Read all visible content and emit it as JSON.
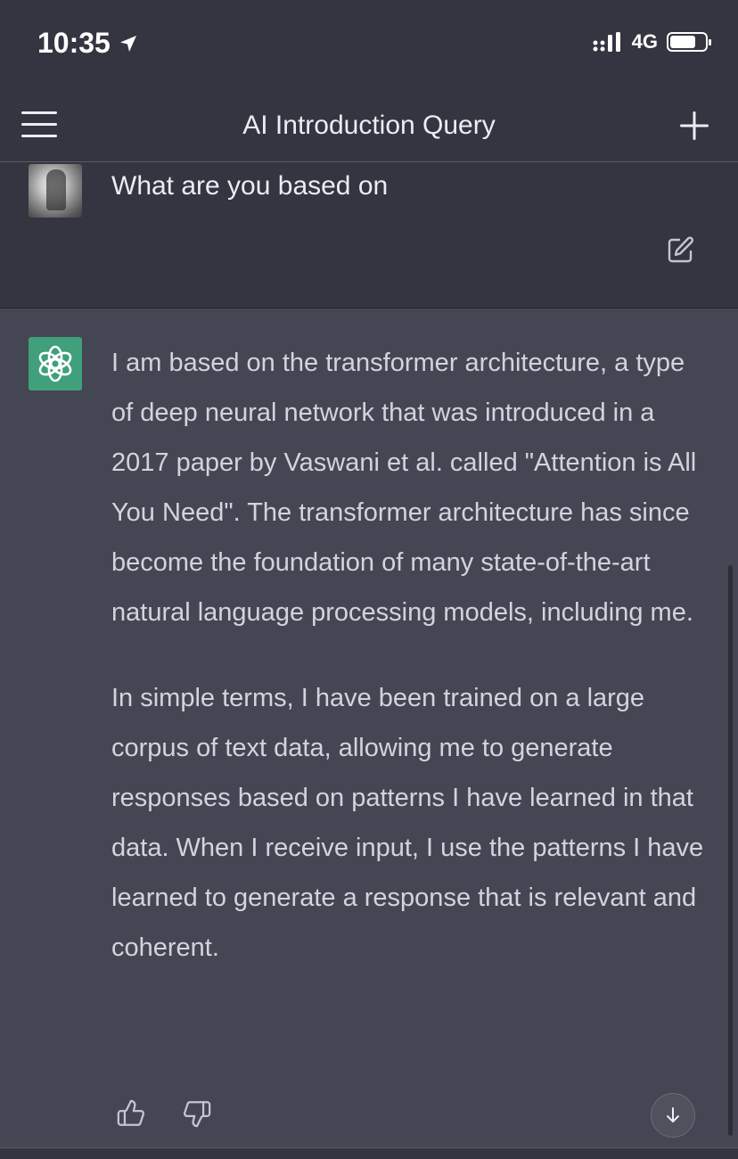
{
  "status_bar": {
    "time": "10:35",
    "network": "4G",
    "icons": [
      "location-arrow-icon",
      "signal-icon",
      "battery-icon"
    ]
  },
  "header": {
    "title": "AI Introduction Query",
    "icons": [
      "menu-icon",
      "plus-icon"
    ]
  },
  "conversation": {
    "user_message": "What are you based on",
    "assistant_paragraphs": [
      "I am based on the transformer architecture, a type of deep neural network that was introduced in a 2017 paper by Vaswani et al. called \"Attention is All You Need\". The transformer architecture has since become the foundation of many state-of-the-art natural language processing models, including me.",
      "In simple terms, I have been trained on a large corpus of text data, allowing me to generate responses based on patterns I have learned in that data. When I receive input, I use the patterns I have learned to generate a response that is relevant and coherent."
    ],
    "icons": [
      "edit-icon",
      "openai-logo-icon",
      "thumbs-up-icon",
      "thumbs-down-icon",
      "arrow-down-icon"
    ]
  },
  "colors": {
    "background": "#343541",
    "assistant_background": "#444654",
    "assistant_avatar": "#3fa07b",
    "text": "#d1d5db"
  }
}
